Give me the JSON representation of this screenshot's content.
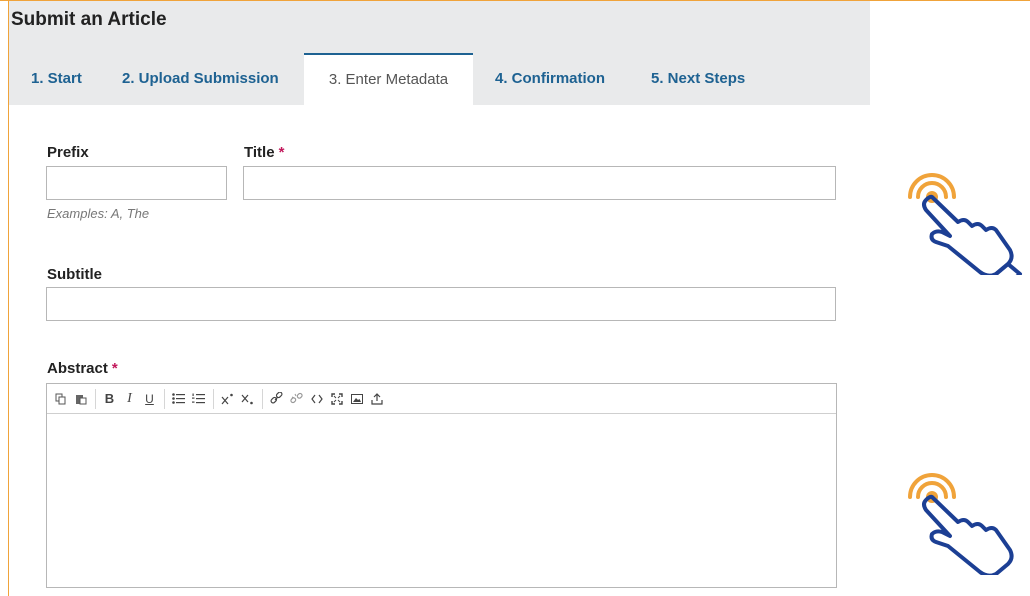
{
  "header": {
    "title": "Submit an Article"
  },
  "tabs": [
    {
      "label": "1. Start"
    },
    {
      "label": "2. Upload Submission"
    },
    {
      "label": "3. Enter Metadata"
    },
    {
      "label": "4. Confirmation"
    },
    {
      "label": "5. Next Steps"
    }
  ],
  "active_tab": "3. Enter Metadata",
  "form": {
    "prefix": {
      "label": "Prefix",
      "value": "",
      "hint": "Examples: A, The"
    },
    "title": {
      "label": "Title",
      "required_mark": "*",
      "value": ""
    },
    "subtitle": {
      "label": "Subtitle",
      "value": ""
    },
    "abstract": {
      "label": "Abstract",
      "required_mark": "*",
      "value": ""
    }
  },
  "toolbar": {
    "buttons": [
      "copy-icon",
      "paste-icon",
      "bold-icon",
      "italic-icon",
      "underline-icon",
      "bullet-list-icon",
      "numbered-list-icon",
      "superscript-icon",
      "subscript-icon",
      "link-icon",
      "unlink-icon",
      "code-icon",
      "fullscreen-icon",
      "image-icon",
      "upload-icon"
    ],
    "glyphs": {
      "bold": "B",
      "italic": "I",
      "underline": "U"
    }
  },
  "colors": {
    "accent": "#1e6292",
    "required": "#c2185b",
    "hand_outline": "#1c3f94",
    "hand_ripple": "#f0a33a",
    "frame": "#f0a33a",
    "header_bg": "#e9eaeb"
  }
}
